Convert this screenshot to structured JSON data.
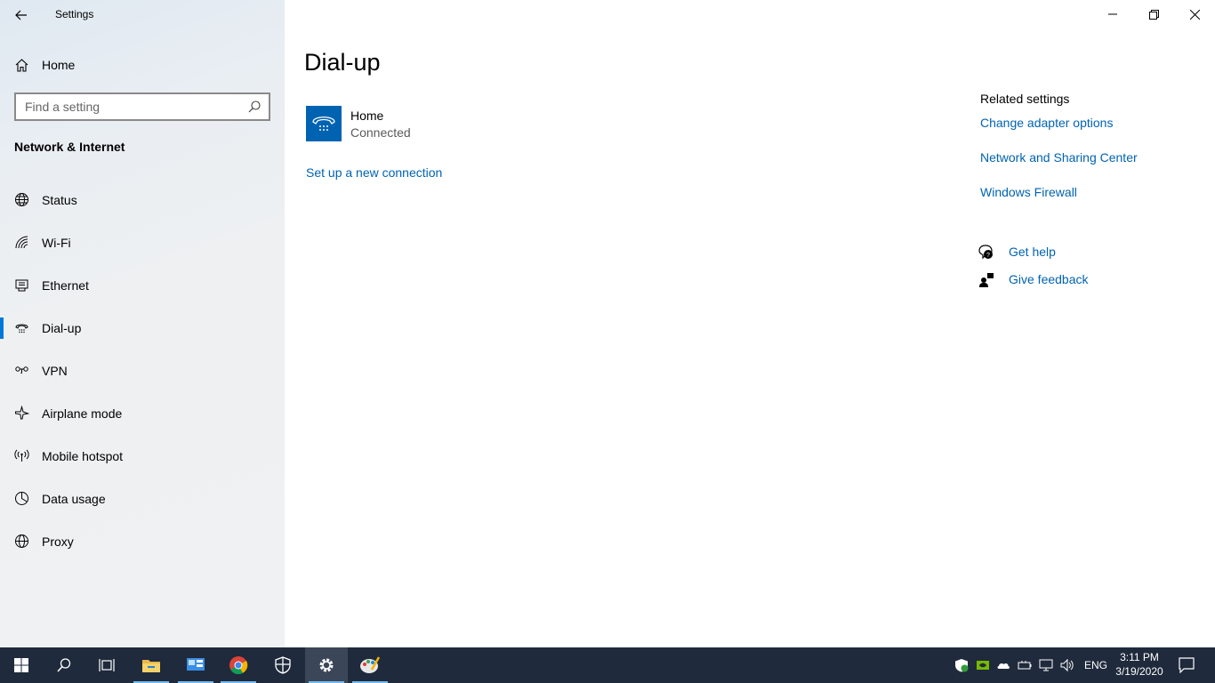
{
  "window": {
    "title": "Settings",
    "controls": [
      "minimize-icon",
      "restore-icon",
      "close-icon"
    ]
  },
  "sidebar": {
    "home_label": "Home",
    "search_placeholder": "Find a setting",
    "section_title": "Network & Internet",
    "items": [
      {
        "label": "Status",
        "icon": "globe-icon",
        "active": false
      },
      {
        "label": "Wi-Fi",
        "icon": "wifi-icon",
        "active": false
      },
      {
        "label": "Ethernet",
        "icon": "ethernet-icon",
        "active": false
      },
      {
        "label": "Dial-up",
        "icon": "dialup-icon",
        "active": true
      },
      {
        "label": "VPN",
        "icon": "vpn-icon",
        "active": false
      },
      {
        "label": "Airplane mode",
        "icon": "airplane-icon",
        "active": false
      },
      {
        "label": "Mobile hotspot",
        "icon": "hotspot-icon",
        "active": false
      },
      {
        "label": "Data usage",
        "icon": "data-usage-icon",
        "active": false
      },
      {
        "label": "Proxy",
        "icon": "proxy-globe-icon",
        "active": false
      }
    ]
  },
  "main": {
    "title": "Dial-up",
    "connection": {
      "name": "Home",
      "status": "Connected"
    },
    "setup_link": "Set up a new connection",
    "related_title": "Related settings",
    "related_links": [
      "Change adapter options",
      "Network and Sharing Center",
      "Windows Firewall"
    ],
    "get_help": "Get help",
    "give_feedback": "Give feedback"
  },
  "taskbar": {
    "apps": [
      "start-icon",
      "search-icon",
      "task-view-icon",
      "file-explorer-icon",
      "control-panel-icon",
      "chrome-icon",
      "security-icon",
      "settings-gear-icon",
      "paint-icon"
    ],
    "language": "ENG",
    "time": "3:11 PM",
    "date": "3/19/2020"
  },
  "colors": {
    "accent": "#0078d7",
    "link": "#0063b1",
    "taskbar": "#1f2a3c"
  }
}
